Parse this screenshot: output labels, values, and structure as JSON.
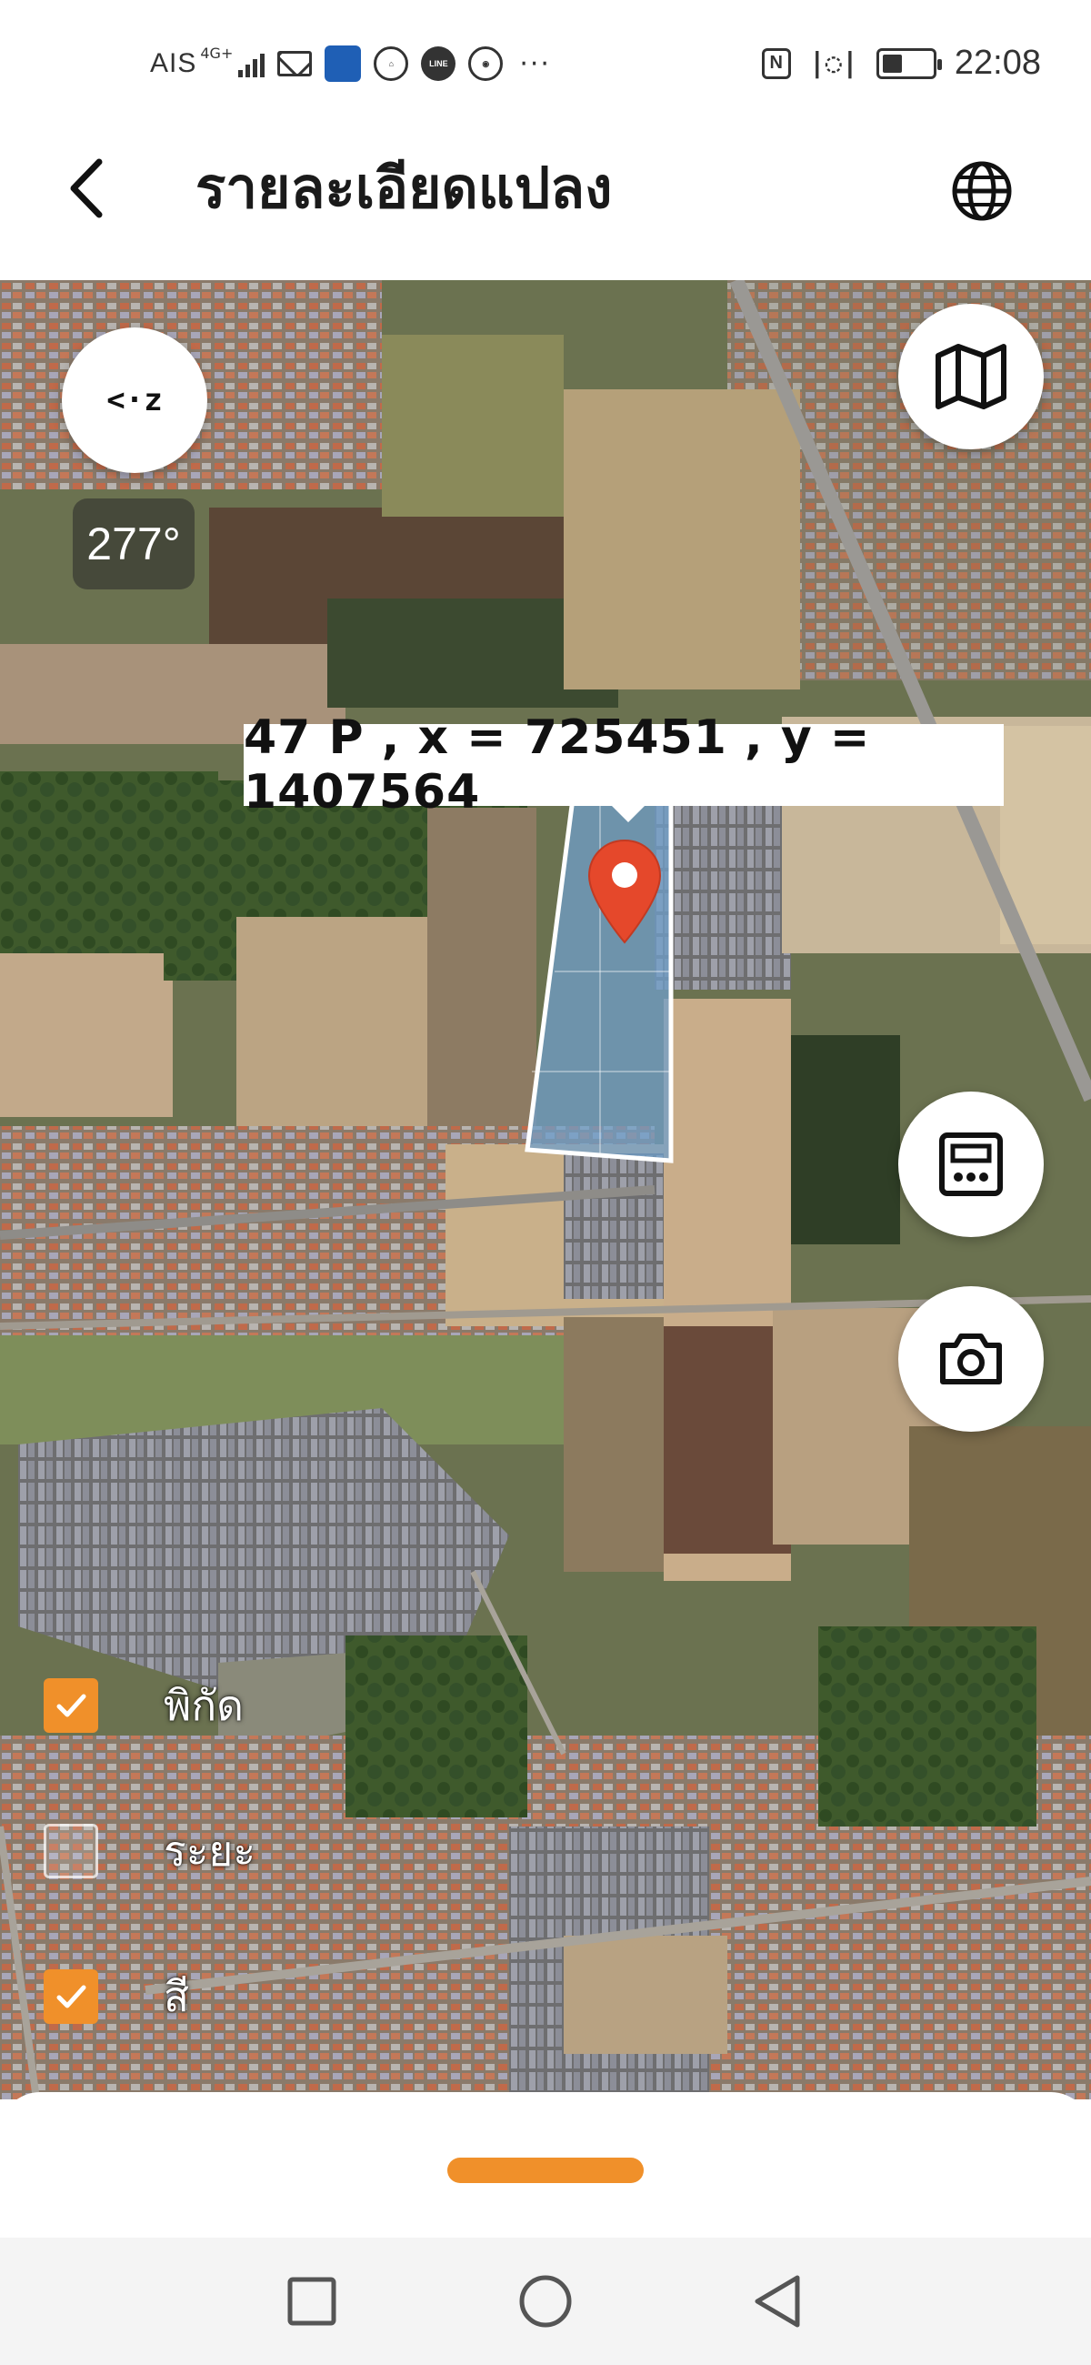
{
  "status_bar": {
    "carrier": "AIS",
    "network": "4G+",
    "time": "22:08",
    "nfc": "N",
    "vibrate": "|◌|",
    "line_icon_text": "LINE",
    "more": "···",
    "icons": [
      "signal-icon",
      "mail-icon",
      "app-icon",
      "home-icon",
      "line-icon",
      "chrome-icon",
      "nfc-icon",
      "vibrate-icon",
      "battery-icon"
    ]
  },
  "header": {
    "title": "รายละเอียดแปลง",
    "back_icon": "chevron-left-icon",
    "language_icon": "globe-icon"
  },
  "map": {
    "compass_label": "<·z",
    "bearing": "277°",
    "coordinate_label": "47 P , x = 725451 , y = 1407564",
    "buttons": [
      "compass-icon",
      "map-layers-icon",
      "measure-icon",
      "camera-icon"
    ]
  },
  "toggles": [
    {
      "label": "พิกัด",
      "checked": true
    },
    {
      "label": "ระยะ",
      "checked": false
    },
    {
      "label": "สี",
      "checked": true
    }
  ],
  "colors": {
    "accent": "#f0902a",
    "pin": "#e5482b",
    "parcel_fill": "#6f9fc9"
  },
  "navbar": {
    "items": [
      "recent-apps-icon",
      "home-icon",
      "back-icon"
    ]
  }
}
